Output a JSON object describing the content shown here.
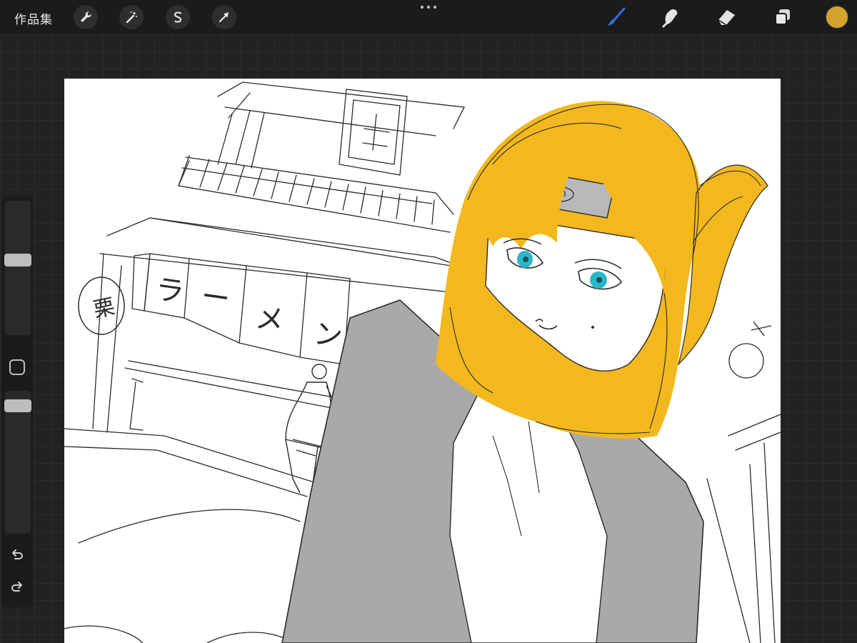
{
  "app": {
    "gallery_label": "作品集"
  },
  "toolbar_left": {
    "actions_icon": "wrench-icon",
    "adjustments_icon": "magic-wand-icon",
    "selection_icon": "selection-s-icon",
    "transform_icon": "arrow-cursor-icon"
  },
  "toolbar_right": {
    "brush_icon": "brush-icon",
    "smudge_icon": "smudge-icon",
    "eraser_icon": "eraser-icon",
    "layers_icon": "layers-icon",
    "current_color": "#D4A32E",
    "brush_active_color": "#2E6FE0"
  },
  "sidebar": {
    "brush_size_icon": "slider-handle",
    "modify_icon": "square-icon",
    "opacity_icon": "slider-handle",
    "undo_icon": "undo-icon",
    "redo_icon": "redo-icon"
  },
  "canvas": {
    "sign_chars": [
      "ラ",
      "ー",
      "メ",
      "ン"
    ],
    "lantern_char": "栗",
    "palette": {
      "hair": "#F2B81E",
      "eyes": "#2BB6C9",
      "jacket": "#A9A9A9",
      "headband": "#B8B8B8",
      "lines": "#2A2A2A"
    }
  }
}
